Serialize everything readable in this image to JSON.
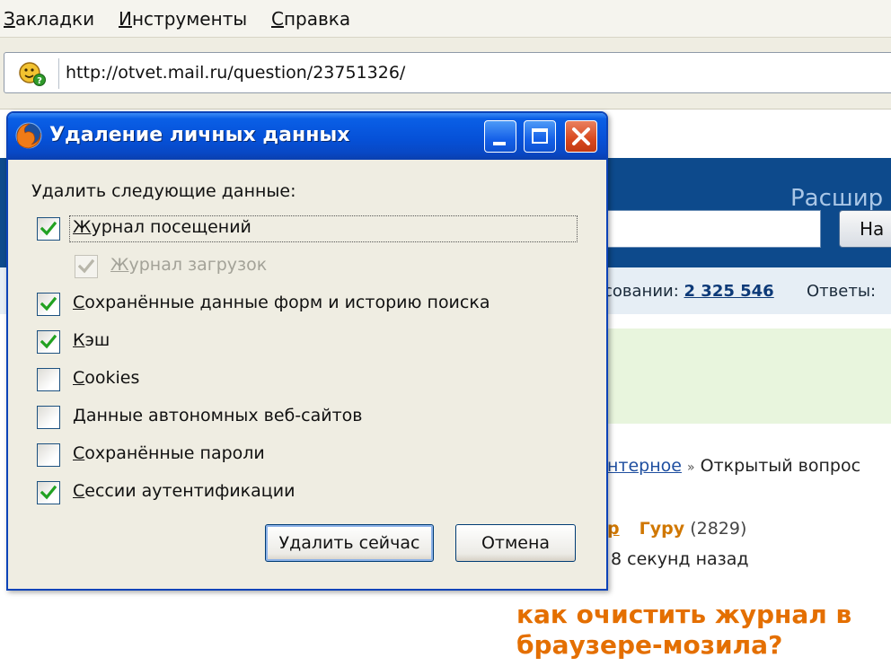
{
  "browser": {
    "menu": [
      "Закладки",
      "Инструменты",
      "Справка"
    ],
    "url": "http://otvet.mail.ru/question/23751326/"
  },
  "page": {
    "search_label": "Расшир",
    "search_button": "На",
    "stats_prefix": "совании: ",
    "stats_count": "2 325 546",
    "stats_answers": "Ответы:",
    "breadcrumb_link": "нтерное",
    "breadcrumb_sep": "»",
    "breadcrumb_current": "Открытый вопрос",
    "author_link": "р",
    "author_rank": "Гуру",
    "author_score": "(2829)",
    "posted": "8 секунд назад",
    "question_title": "как очистить журнал в браузере-мозила?"
  },
  "dialog": {
    "title": "Удаление личных данных",
    "section_label": "Удалить следующие данные:",
    "options": [
      {
        "label": "Журнал посещений",
        "checked": true,
        "disabled": false
      },
      {
        "label": "Журнал загрузок",
        "checked": true,
        "disabled": true
      },
      {
        "label": "Сохранённые данные форм и историю поиска",
        "checked": true,
        "disabled": false
      },
      {
        "label": "Кэш",
        "checked": true,
        "disabled": false
      },
      {
        "label": "Cookies",
        "checked": false,
        "disabled": false
      },
      {
        "label": "Данные автономных веб-сайтов",
        "checked": false,
        "disabled": false
      },
      {
        "label": "Сохранённые пароли",
        "checked": false,
        "disabled": false
      },
      {
        "label": "Сессии аутентификации",
        "checked": true,
        "disabled": false
      }
    ],
    "buttons": {
      "delete_now": "Удалить сейчас",
      "cancel": "Отмена"
    }
  },
  "colors": {
    "titlebar": "#0651d8",
    "checkmark": "#21a121",
    "checkmark_disabled": "#b8b6aa",
    "question_title": "#e46f00"
  },
  "icons": [
    "question-bubble-icon",
    "firefox-icon",
    "minimize-icon",
    "maximize-icon",
    "close-icon",
    "checkmark-icon"
  ]
}
